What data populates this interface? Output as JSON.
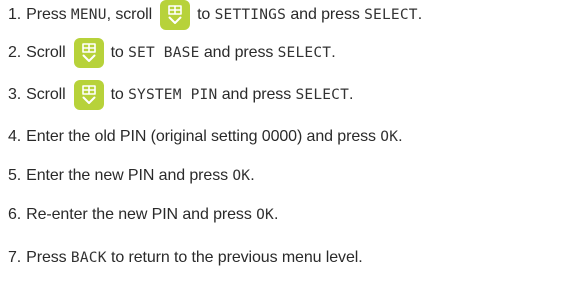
{
  "accent_color": "#b7d23a",
  "steps": [
    {
      "num": "1.",
      "parts": [
        {
          "t": "text",
          "v": "Press "
        },
        {
          "t": "lcd",
          "v": "MENU"
        },
        {
          "t": "text",
          "v": ", scroll"
        },
        {
          "t": "key",
          "icon": "phonebook-down-key-icon"
        },
        {
          "t": "text",
          "v": "to "
        },
        {
          "t": "lcd",
          "v": "SETTINGS"
        },
        {
          "t": "text",
          "v": " and press "
        },
        {
          "t": "lcd",
          "v": "SELECT"
        },
        {
          "t": "text",
          "v": "."
        }
      ]
    },
    {
      "num": "2.",
      "parts": [
        {
          "t": "text",
          "v": "Scroll"
        },
        {
          "t": "key",
          "icon": "phonebook-down-key-icon"
        },
        {
          "t": "text",
          "v": "to "
        },
        {
          "t": "lcd",
          "v": "SET BASE"
        },
        {
          "t": "text",
          "v": " and press "
        },
        {
          "t": "lcd",
          "v": "SELECT"
        },
        {
          "t": "text",
          "v": "."
        }
      ]
    },
    {
      "num": "3.",
      "parts": [
        {
          "t": "text",
          "v": "Scroll"
        },
        {
          "t": "key",
          "icon": "phonebook-down-key-icon"
        },
        {
          "t": "text",
          "v": "to "
        },
        {
          "t": "lcd",
          "v": "SYSTEM PIN"
        },
        {
          "t": "text",
          "v": " and press "
        },
        {
          "t": "lcd",
          "v": "SELECT"
        },
        {
          "t": "text",
          "v": "."
        }
      ]
    },
    {
      "num": "4.",
      "parts": [
        {
          "t": "text",
          "v": "Enter the old PIN (original setting 0000) and press "
        },
        {
          "t": "lcd",
          "v": "OK"
        },
        {
          "t": "text",
          "v": "."
        }
      ]
    },
    {
      "num": "5.",
      "parts": [
        {
          "t": "text",
          "v": "Enter the new PIN and press "
        },
        {
          "t": "lcd",
          "v": "OK"
        },
        {
          "t": "text",
          "v": "."
        }
      ]
    },
    {
      "num": "6.",
      "parts": [
        {
          "t": "text",
          "v": "Re-enter the new PIN and press "
        },
        {
          "t": "lcd",
          "v": "OK"
        },
        {
          "t": "text",
          "v": "."
        }
      ]
    },
    {
      "num": "7.",
      "parts": [
        {
          "t": "text",
          "v": "Press "
        },
        {
          "t": "lcd",
          "v": "BACK"
        },
        {
          "t": "text",
          "v": " to return to the previous menu level."
        }
      ]
    }
  ]
}
